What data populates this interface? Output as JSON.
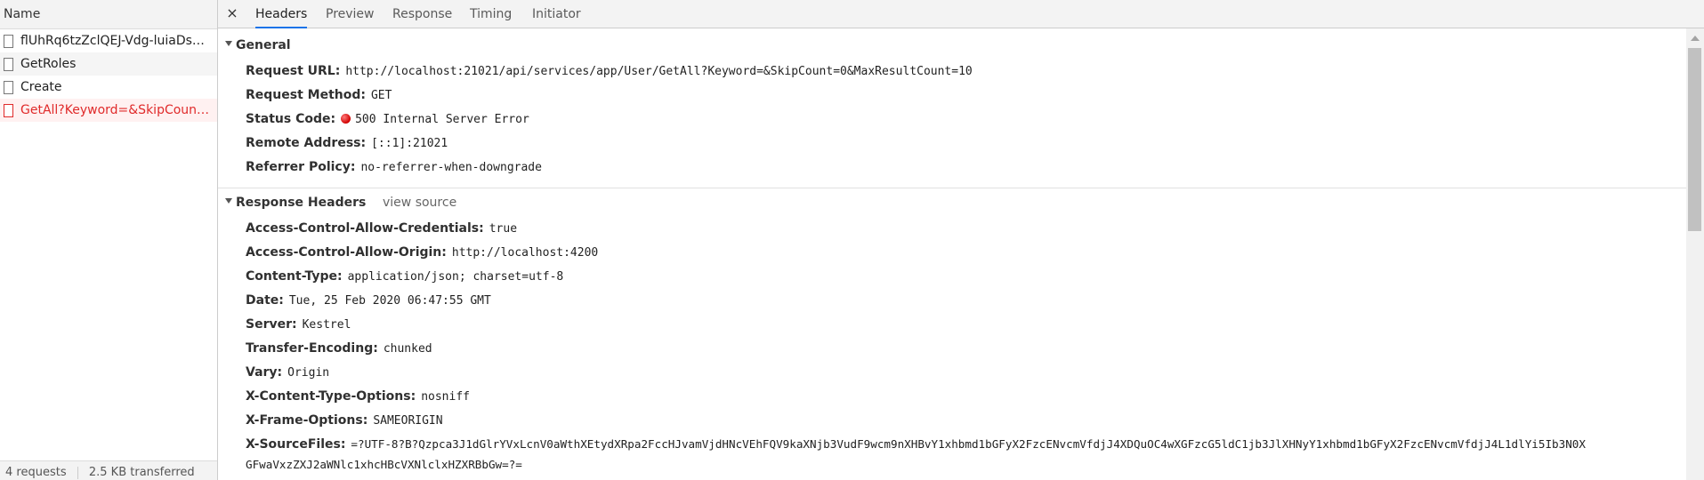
{
  "left_panel": {
    "header": "Name",
    "requests": [
      {
        "name": "flUhRq6tzZclQEJ-Vdg-luiaDsN...",
        "status": "normal"
      },
      {
        "name": "GetRoles",
        "status": "normal"
      },
      {
        "name": "Create",
        "status": "normal"
      },
      {
        "name": "GetAll?Keyword=&SkipCount...",
        "status": "error"
      }
    ],
    "footer": {
      "requests": "4 requests",
      "transferred": "2.5 KB transferred"
    }
  },
  "tabs": [
    {
      "label": "Headers",
      "active": true
    },
    {
      "label": "Preview",
      "active": false
    },
    {
      "label": "Response",
      "active": false
    },
    {
      "label": "Timing",
      "active": false
    },
    {
      "label": "Initiator",
      "active": false
    }
  ],
  "close_icon": "×",
  "general": {
    "title": "General",
    "rows": [
      {
        "key": "Request URL:",
        "value": "http://localhost:21021/api/services/app/User/GetAll?Keyword=&SkipCount=0&MaxResultCount=10"
      },
      {
        "key": "Request Method:",
        "value": "GET"
      },
      {
        "key": "Status Code:",
        "value": "500 Internal Server Error"
      },
      {
        "key": "Remote Address:",
        "value": "[::1]:21021"
      },
      {
        "key": "Referrer Policy:",
        "value": "no-referrer-when-downgrade"
      }
    ]
  },
  "response_headers": {
    "title": "Response Headers",
    "view_source": "view source",
    "rows": [
      {
        "key": "Access-Control-Allow-Credentials:",
        "value": "true"
      },
      {
        "key": "Access-Control-Allow-Origin:",
        "value": "http://localhost:4200"
      },
      {
        "key": "Content-Type:",
        "value": "application/json; charset=utf-8"
      },
      {
        "key": "Date:",
        "value": "Tue, 25 Feb 2020 06:47:55 GMT"
      },
      {
        "key": "Server:",
        "value": "Kestrel"
      },
      {
        "key": "Transfer-Encoding:",
        "value": "chunked"
      },
      {
        "key": "Vary:",
        "value": "Origin"
      },
      {
        "key": "X-Content-Type-Options:",
        "value": "nosniff"
      },
      {
        "key": "X-Frame-Options:",
        "value": "SAMEORIGIN"
      },
      {
        "key": "X-SourceFiles:",
        "value": "=?UTF-8?B?Qzpca3J1dGlrYVxLcnV0aWthXEtydXRpa2FccHJvamVjdHNcVEhFQV9kaXNjb3VudF9wcm9nXHBvY1xhbmd1bGFyX2FzcENvcmVfdjJ4XDQuOC4wXGFzcG5ldC1jb3JlXHNyY1xhbmd1bGFyX2FzcENvcmVfdjJ4L1dlYi5Ib3N0X"
      },
      {
        "key": "",
        "value": "GFwaVxzZXJ2aWNlc1xhcHBcVXNlclxHZXRBbGw=?="
      }
    ]
  },
  "colors": {
    "error": "#e02a2a",
    "accent": "#1a73e8",
    "status_dot": "#d10000"
  }
}
